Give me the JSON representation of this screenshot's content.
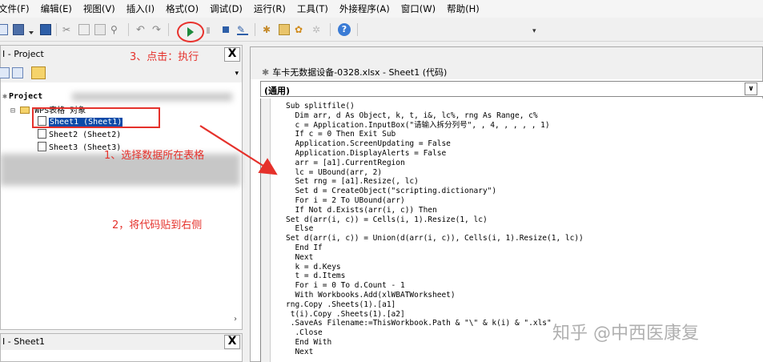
{
  "menu": [
    "文件(F)",
    "编辑(E)",
    "视图(V)",
    "插入(I)",
    "格式(O)",
    "调试(D)",
    "运行(R)",
    "工具(T)",
    "外接程序(A)",
    "窗口(W)",
    "帮助(H)"
  ],
  "project_pane": {
    "title": "I - Project",
    "close": "X",
    "tree": {
      "root": "Project",
      "folder": "WPS表格 对象",
      "items": [
        "Sheet1 (Sheet1)",
        "Sheet2 (Sheet2)",
        "Sheet3 (Sheet3)"
      ]
    }
  },
  "properties_pane": {
    "title": "I - Sheet1",
    "close": "X"
  },
  "code_window": {
    "title": "车卡无数据设备-0328.xlsx - Sheet1 (代码)",
    "object_combo": "(通用)",
    "lines": [
      "Sub splitfile()",
      "  Dim arr, d As Object, k, t, i&, lc%, rng As Range, c%",
      "  c = Application.InputBox(\"请输入拆分列号\", , 4, , , , , 1)",
      "  If c = 0 Then Exit Sub",
      "  Application.ScreenUpdating = False",
      "  Application.DisplayAlerts = False",
      "  arr = [a1].CurrentRegion",
      "  lc = UBound(arr, 2)",
      "  Set rng = [a1].Resize(, lc)",
      "  Set d = CreateObject(\"scripting.dictionary\")",
      "  For i = 2 To UBound(arr)",
      "  If Not d.Exists(arr(i, c)) Then",
      "Set d(arr(i, c)) = Cells(i, 1).Resize(1, lc)",
      "  Else",
      "Set d(arr(i, c)) = Union(d(arr(i, c)), Cells(i, 1).Resize(1, lc))",
      "  End If",
      "  Next",
      "  k = d.Keys",
      "  t = d.Items",
      "  For i = 0 To d.Count - 1",
      "  With Workbooks.Add(xlWBATWorksheet)",
      "rng.Copy .Sheets(1).[a1]",
      " t(i).Copy .Sheets(1).[a2]",
      " .SaveAs Filename:=ThisWorkbook.Path & \"\\\" & k(i) & \".xls\"",
      "  .Close",
      "  End With",
      "  Next"
    ]
  },
  "annotations": {
    "step1": "1、选择数据所在表格",
    "step2": "2，将代码贴到右侧",
    "step3": "3、点击：执行"
  },
  "watermark": "知乎 @中西医康复",
  "colors": {
    "annotation": "#e5312b",
    "run_icon": "#1d8a3c"
  }
}
